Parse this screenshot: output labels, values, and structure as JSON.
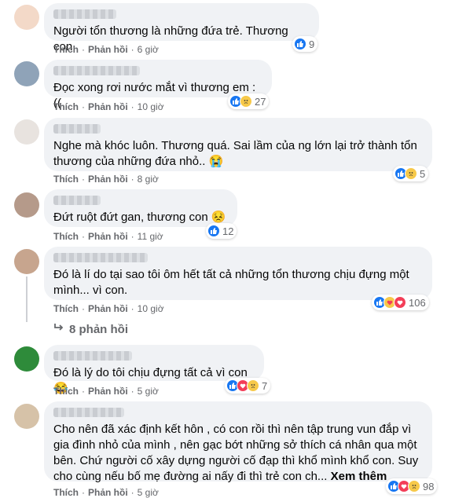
{
  "actions": {
    "like": "Thích",
    "reply": "Phản hồi",
    "dot": "·"
  },
  "colors": {
    "like": "#1877f2",
    "sad": "#f7c94a",
    "heart": "#f33e58",
    "bubble": "#f0f2f5"
  },
  "comments": [
    {
      "text": "Người tổn thương là những đứa trẻ. Thương con",
      "time": "6 giờ",
      "reactions": [
        "like-icon"
      ],
      "count": "9"
    },
    {
      "text": "Đọc xong rơi nước mắt vì thương em :((",
      "time": "10 giờ",
      "reactions": [
        "like-icon",
        "sad-icon"
      ],
      "count": "27"
    },
    {
      "text": "Nghe mà khóc luôn. Thương quá. Sai lầm của ng lớn lại trở thành tổn thương của những đứa nhỏ.. 😭",
      "time": "8 giờ",
      "reactions": [
        "like-icon",
        "sad-icon"
      ],
      "count": "5"
    },
    {
      "text": "Đứt ruột đứt gan, thương con 😣",
      "time": "11 giờ",
      "reactions": [
        "like-icon"
      ],
      "count": "12"
    },
    {
      "text": "Đó là lí do tại sao tôi ôm hết tất cả những tổn thương chịu đựng một mình... vì con.",
      "time": "10 giờ",
      "reactions": [
        "like-icon",
        "care-icon",
        "heart-icon"
      ],
      "count": "106",
      "replies": "8 phản hồi"
    },
    {
      "text": "Đó là lý do tôi chịu đựng tất cả vì con😂",
      "time": "5 giờ",
      "reactions": [
        "like-icon",
        "heart-icon",
        "sad-icon"
      ],
      "count": "7"
    },
    {
      "text": "Cho nên đã xác định kết hôn , có con rồi thì nên tập trung vun đắp vì gia đình nhỏ của mình , nên gạc bớt những sở thích cá nhân qua một bên. Chứ người cố xây dựng người cố đạp thì khổ mình khổ con. Suy cho cùng nếu bố mẹ đường ai nấy đi thì trẻ con ch...",
      "see_more": "Xem thêm",
      "time": "5 giờ",
      "reactions": [
        "like-icon",
        "heart-icon",
        "sad-icon"
      ],
      "count": "98"
    }
  ]
}
